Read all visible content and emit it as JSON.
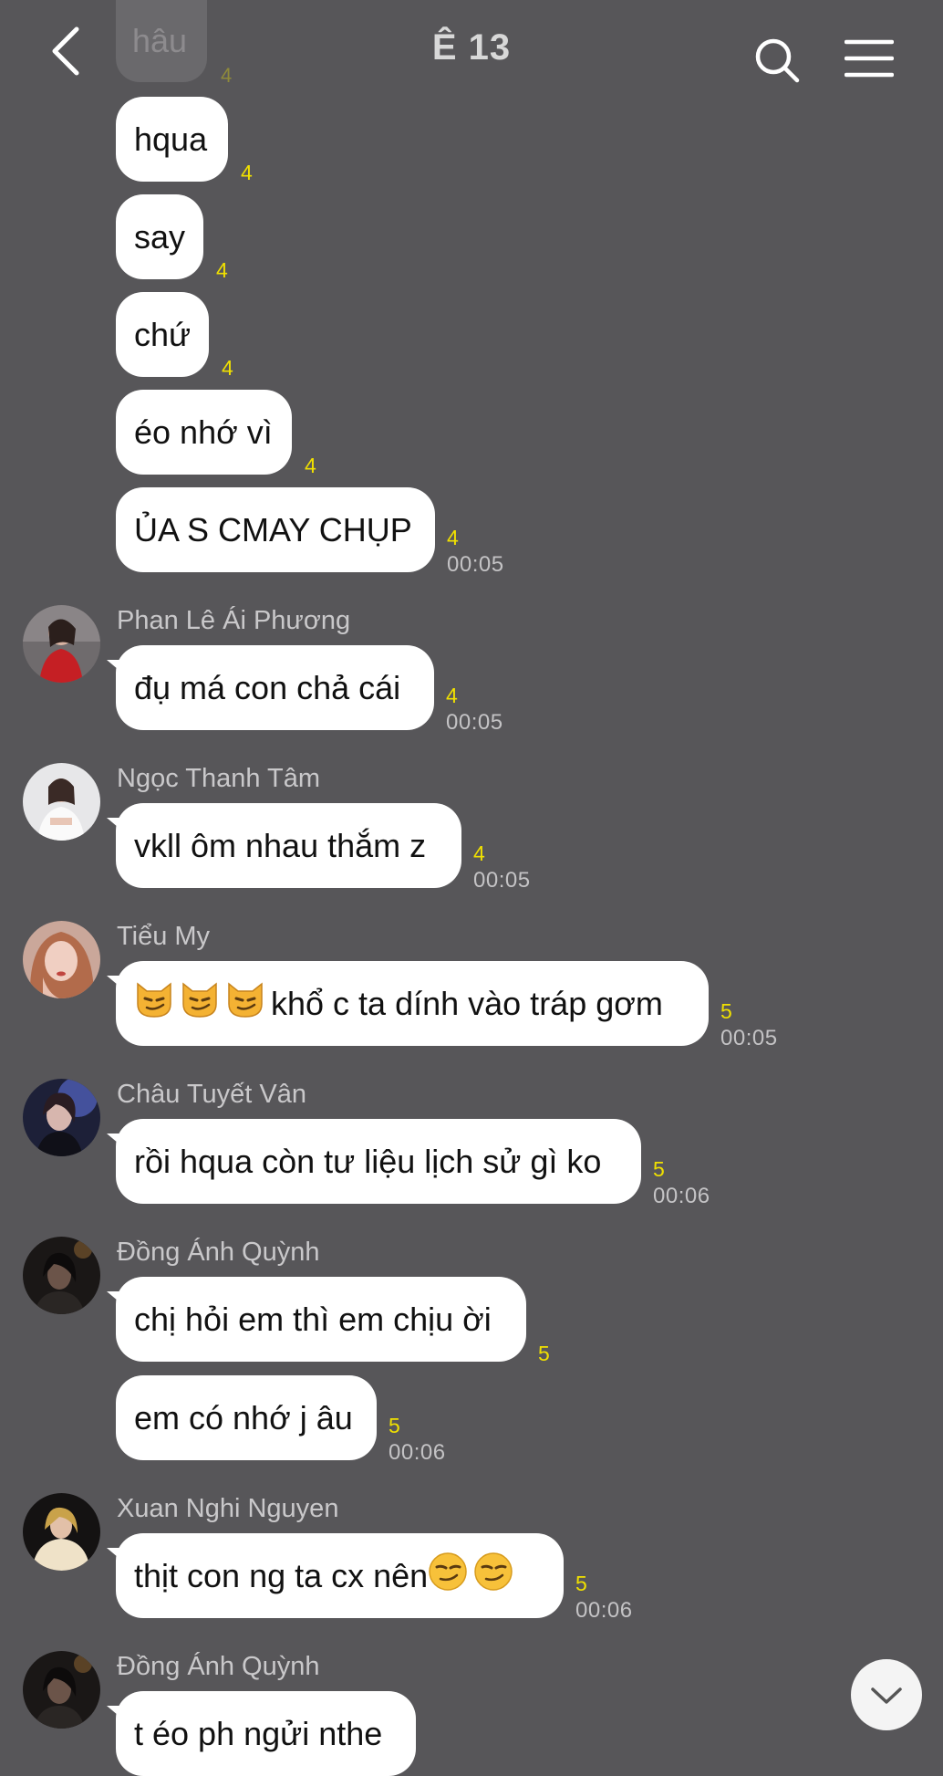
{
  "header": {
    "title": "Ê 13",
    "back_icon": "chevron-left-icon",
    "search_icon": "search-icon",
    "menu_icon": "hamburger-menu-icon"
  },
  "colors": {
    "background": "#575659",
    "bubble": "#ffffff",
    "read_count": "#f0e000"
  },
  "top_partial": {
    "text": "hâu",
    "count": "4"
  },
  "messages": [
    {
      "text": "hqua",
      "count": "4"
    },
    {
      "text": "say",
      "count": "4"
    },
    {
      "text": "chứ",
      "count": "4"
    },
    {
      "text": "éo nhớ vì",
      "count": "4"
    },
    {
      "text": "ỦA S CMAY CHỤP",
      "count": "4",
      "time": "00:05"
    },
    {
      "sender": "Phan Lê Ái Phương",
      "text": "đụ má con chả cái",
      "count": "4",
      "time": "00:05"
    },
    {
      "sender": "Ngọc Thanh Tâm",
      "text": "vkll ôm nhau thắm z",
      "count": "4",
      "time": "00:05"
    },
    {
      "sender": "Tiểu My",
      "text": "khổ c ta dính vào tráp gơm",
      "count": "5",
      "time": "00:05",
      "emojis": [
        "smirking-cat-emoji",
        "smirking-cat-emoji",
        "smirking-cat-emoji"
      ]
    },
    {
      "sender": "Châu Tuyết Vân",
      "text": "rồi hqua còn tư liệu lịch sử gì ko",
      "count": "5",
      "time": "00:06"
    },
    {
      "sender": "Đồng Ánh Quỳnh",
      "text": "chị hỏi em thì em chịu ời",
      "count": "5"
    },
    {
      "text": "em có nhớ j âu",
      "count": "5",
      "time": "00:06"
    },
    {
      "sender": "Xuan Nghi Nguyen",
      "text": "thịt con ng ta cx nên",
      "count": "5",
      "time": "00:06",
      "emojis": [
        "smirking-face-emoji",
        "smirking-face-emoji"
      ]
    },
    {
      "sender": "Đồng Ánh Quỳnh",
      "text": "t éo ph ngửi nthe"
    }
  ],
  "scroll_down_icon": "chevron-down-icon"
}
